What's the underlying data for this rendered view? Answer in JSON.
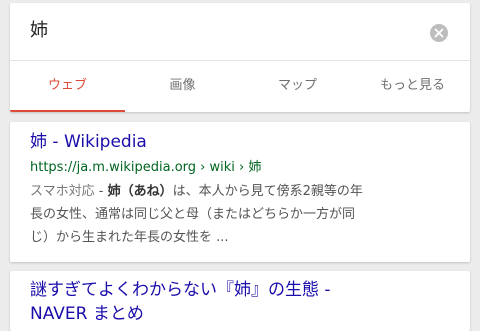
{
  "search": {
    "query": "姉"
  },
  "tabs": [
    {
      "label": "ウェブ",
      "active": true
    },
    {
      "label": "画像",
      "active": false
    },
    {
      "label": "マップ",
      "active": false
    },
    {
      "label": "もっと見る",
      "active": false
    }
  ],
  "results": [
    {
      "title": "姉 - Wikipedia",
      "url": "https://ja.m.wikipedia.org › wiki › 姉",
      "snippet": {
        "label": "スマホ対応",
        "separator": " - ",
        "bold": "姉（あね）",
        "line1_rest": "は、本人から見て傍系2親等の年",
        "line2": "長の女性、通常は同じ父と母（またはどちらか一方が同",
        "line3": "じ）から生まれた年長の女性を ..."
      }
    },
    {
      "title_line1": "謎すぎてよくわからない『姉』の生態 -",
      "title_line2": "NAVER まとめ"
    }
  ],
  "colors": {
    "accent": "#dd4b39",
    "link": "#1a0dab",
    "url": "#006621",
    "background": "#ececec"
  },
  "icons": {
    "clear": "close-circle-icon"
  }
}
